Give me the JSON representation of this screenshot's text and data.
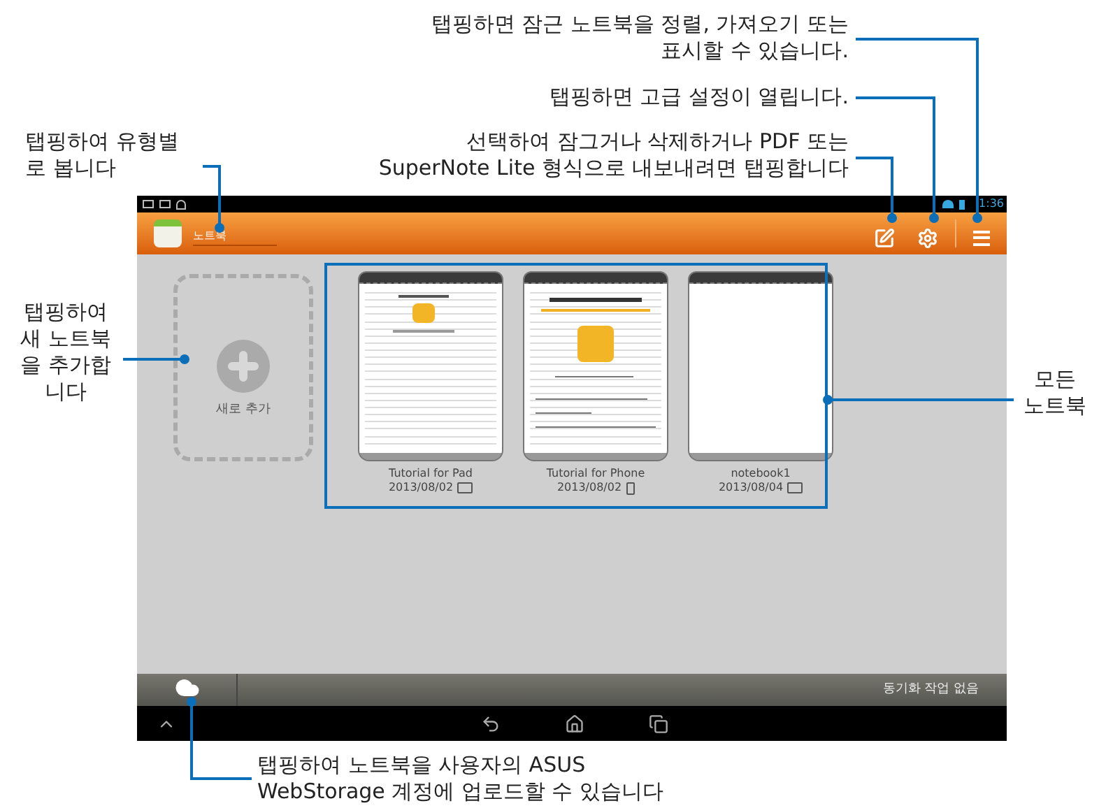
{
  "callouts": [
    {
      "lines": [
        "탭핑하면 잠근 노트북을 정렬, 가져오기 또는",
        "표시할 수 있습니다."
      ]
    },
    {
      "lines": [
        "탭핑하면 고급 설정이 열립니다."
      ]
    },
    {
      "lines": [
        "탭핑하여 유형별",
        "로 봅니다"
      ]
    },
    {
      "lines": [
        "선택하여 잠그거나 삭제하거나 PDF 또는",
        "SuperNote Lite 형식으로 내보내려면 탭핑합니다"
      ]
    },
    {
      "lines": [
        "탭핑하여",
        "새 노트북",
        "을 추가합",
        "니다"
      ]
    },
    {
      "lines": [
        "모든",
        "노트북"
      ]
    },
    {
      "lines": [
        "탭핑하여 노트북을 사용자의 ASUS",
        "WebStorage 계정에 업로드할 수 있습니다"
      ]
    }
  ],
  "status_bar": {
    "time": "1:36"
  },
  "action_bar": {
    "title": "노트북"
  },
  "add_notebook": {
    "label": "새로 추가"
  },
  "notebooks": [
    {
      "name": "Tutorial for Pad",
      "date": "2013/08/02",
      "cover": {
        "kind": "small"
      },
      "device": {
        "kind": "tablet"
      }
    },
    {
      "name": "Tutorial for Phone",
      "date": "2013/08/02",
      "cover": {
        "kind": "large"
      },
      "device": {
        "kind": "phone"
      }
    },
    {
      "name": "notebook1",
      "date": "2013/08/04",
      "cover": {
        "kind": "blank"
      },
      "device": {
        "kind": "tablet"
      }
    }
  ],
  "sync_status": "동기화 작업 없음"
}
